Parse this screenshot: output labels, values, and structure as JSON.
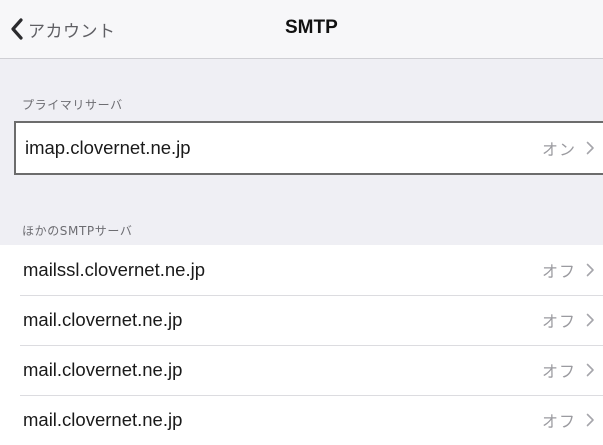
{
  "navbar": {
    "back_label": "アカウント",
    "title": "SMTP"
  },
  "primary_section": {
    "header": "プライマリサーバ",
    "server": {
      "host": "imap.clovernet.ne.jp",
      "status": "オン"
    }
  },
  "other_section": {
    "header": "ほかのSMTPサーバ",
    "servers": [
      {
        "host": "mailssl.clovernet.ne.jp",
        "status": "オフ"
      },
      {
        "host": "mail.clovernet.ne.jp",
        "status": "オフ"
      },
      {
        "host": "mail.clovernet.ne.jp",
        "status": "オフ"
      },
      {
        "host": "mail.clovernet.ne.jp",
        "status": "オフ"
      }
    ]
  },
  "icons": {
    "back": "chevron-left-icon",
    "disclosure": "chevron-right-icon"
  },
  "colors": {
    "background": "#efeff4",
    "navbar": "#f7f7f9",
    "status_text": "#9b9ba0",
    "selection_border": "#6c6c6c"
  }
}
